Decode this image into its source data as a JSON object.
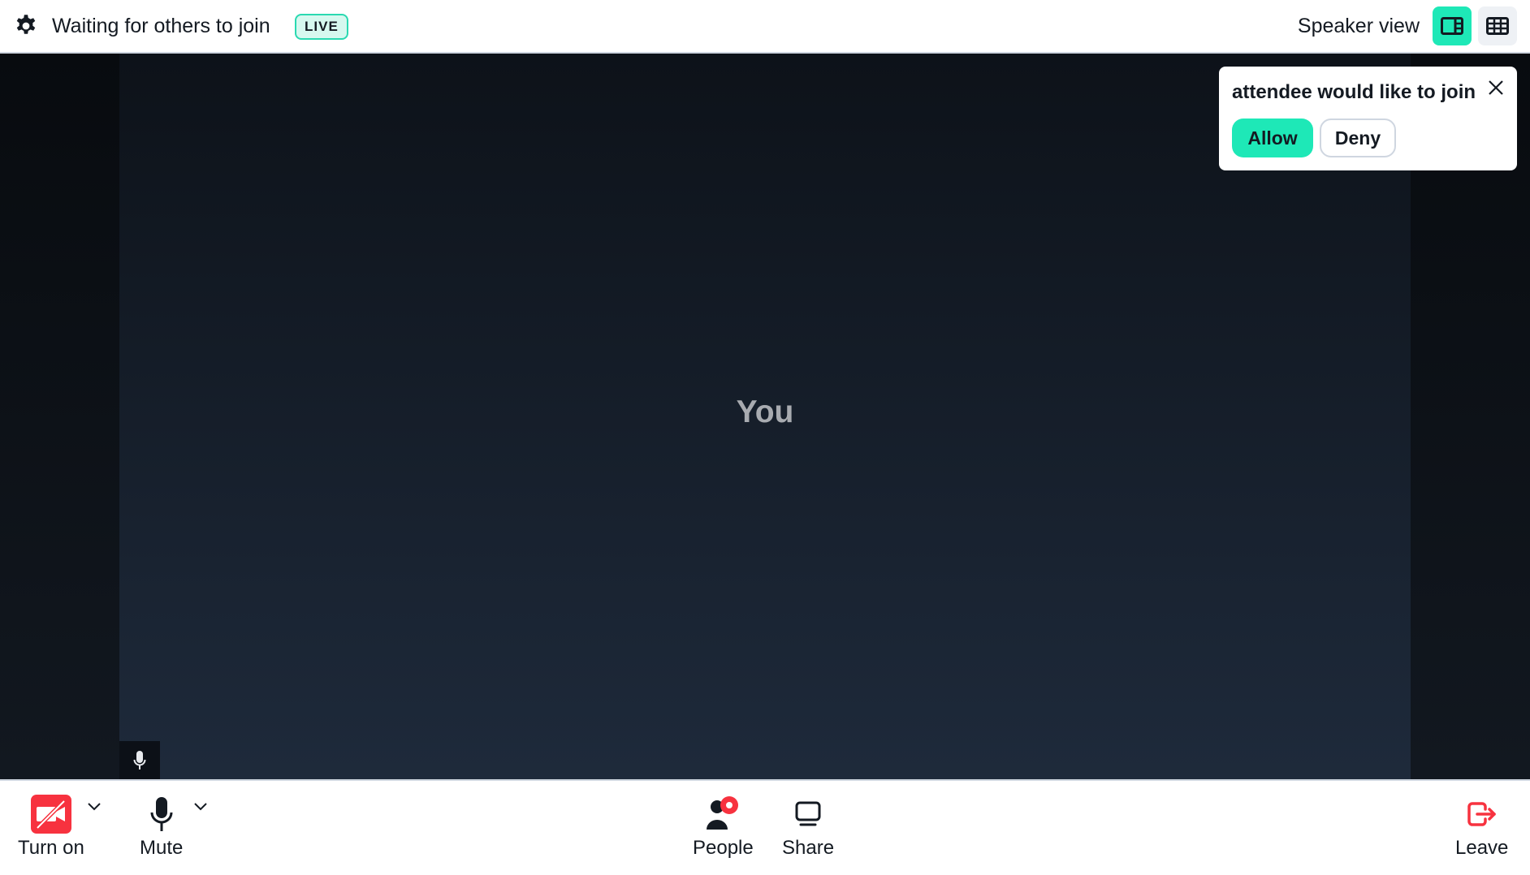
{
  "header": {
    "settings_icon": "gear-icon",
    "status_text": "Waiting for others to join",
    "live_badge": "LIVE",
    "view_label": "Speaker view",
    "view_modes": [
      {
        "name": "speaker",
        "icon": "speaker-layout-icon",
        "active": true
      },
      {
        "name": "grid",
        "icon": "grid-layout-icon",
        "active": false
      }
    ]
  },
  "stage": {
    "self_tile_label": "You",
    "self_mic_icon": "microphone-icon"
  },
  "join_request": {
    "message": "attendee would like to join",
    "allow_label": "Allow",
    "deny_label": "Deny",
    "close_icon": "close-icon"
  },
  "controls": {
    "camera": {
      "label": "Turn on",
      "icon": "camera-off-icon",
      "state": "off"
    },
    "mic": {
      "label": "Mute",
      "icon": "microphone-icon"
    },
    "people": {
      "label": "People",
      "icon": "person-icon",
      "notification": true
    },
    "share": {
      "label": "Share",
      "icon": "screen-share-icon"
    },
    "leave": {
      "label": "Leave",
      "icon": "leave-icon"
    }
  },
  "colors": {
    "accent": "#1ee8b7",
    "danger": "#f7323f",
    "text": "#141a22"
  }
}
